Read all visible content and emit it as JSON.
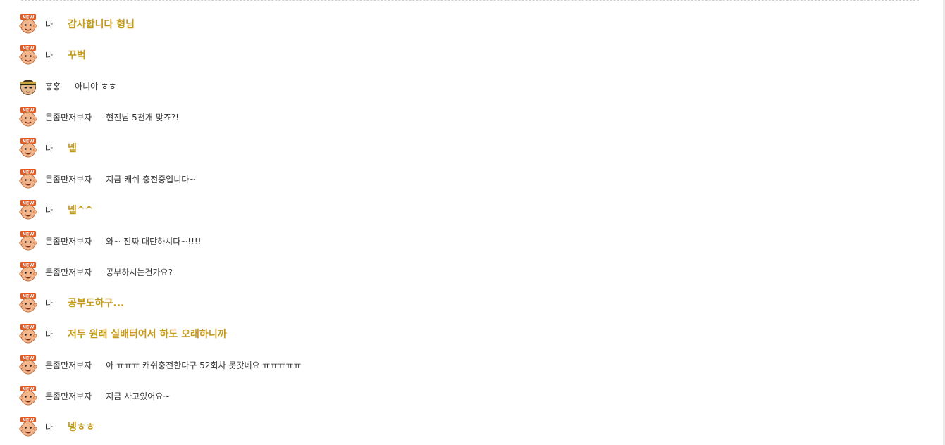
{
  "messages": [
    {
      "nick": "나",
      "text": "감사합니다 형님",
      "mine": true,
      "avatar": "new-badge-face-icon"
    },
    {
      "nick": "나",
      "text": "꾸벅",
      "mine": true,
      "avatar": "new-badge-face-icon"
    },
    {
      "nick": "홍홍",
      "text": "아니야 ㅎㅎ",
      "mine": false,
      "avatar": "capped-character-icon"
    },
    {
      "nick": "돈좀만저보자",
      "text": "현진님 5천개 맞죠?!",
      "mine": false,
      "avatar": "new-badge-face-icon"
    },
    {
      "nick": "나",
      "text": "넵",
      "mine": true,
      "avatar": "new-badge-face-icon"
    },
    {
      "nick": "돈좀만저보자",
      "text": "지금 캐쉬 충전중입니다~",
      "mine": false,
      "avatar": "new-badge-face-icon"
    },
    {
      "nick": "나",
      "text": "넵^^",
      "mine": true,
      "avatar": "new-badge-face-icon"
    },
    {
      "nick": "돈좀만저보자",
      "text": "와~ 진짜 대단하시다~!!!!",
      "mine": false,
      "avatar": "new-badge-face-icon"
    },
    {
      "nick": "돈좀만저보자",
      "text": "공부하시는건가요?",
      "mine": false,
      "avatar": "new-badge-face-icon"
    },
    {
      "nick": "나",
      "text": "공부도하구...",
      "mine": true,
      "avatar": "new-badge-face-icon"
    },
    {
      "nick": "나",
      "text": "저두 원래 실배터여서 하도 오래하니까",
      "mine": true,
      "avatar": "new-badge-face-icon"
    },
    {
      "nick": "돈좀만저보자",
      "text": "아 ㅠㅠㅠ 캐쉬충전한다구 52회차 못갓네요 ㅠㅠㅠㅠㅠ",
      "mine": false,
      "avatar": "new-badge-face-icon"
    },
    {
      "nick": "돈좀만저보자",
      "text": "지금 사고있어요~",
      "mine": false,
      "avatar": "new-badge-face-icon"
    },
    {
      "nick": "나",
      "text": "넹ㅎㅎ",
      "mine": true,
      "avatar": "new-badge-face-icon"
    }
  ],
  "colors": {
    "mine_text": "#c59a1b",
    "other_text": "#333333",
    "new_badge": "#e8581c",
    "face": "#f2b58c"
  },
  "badge_text": "NEW"
}
